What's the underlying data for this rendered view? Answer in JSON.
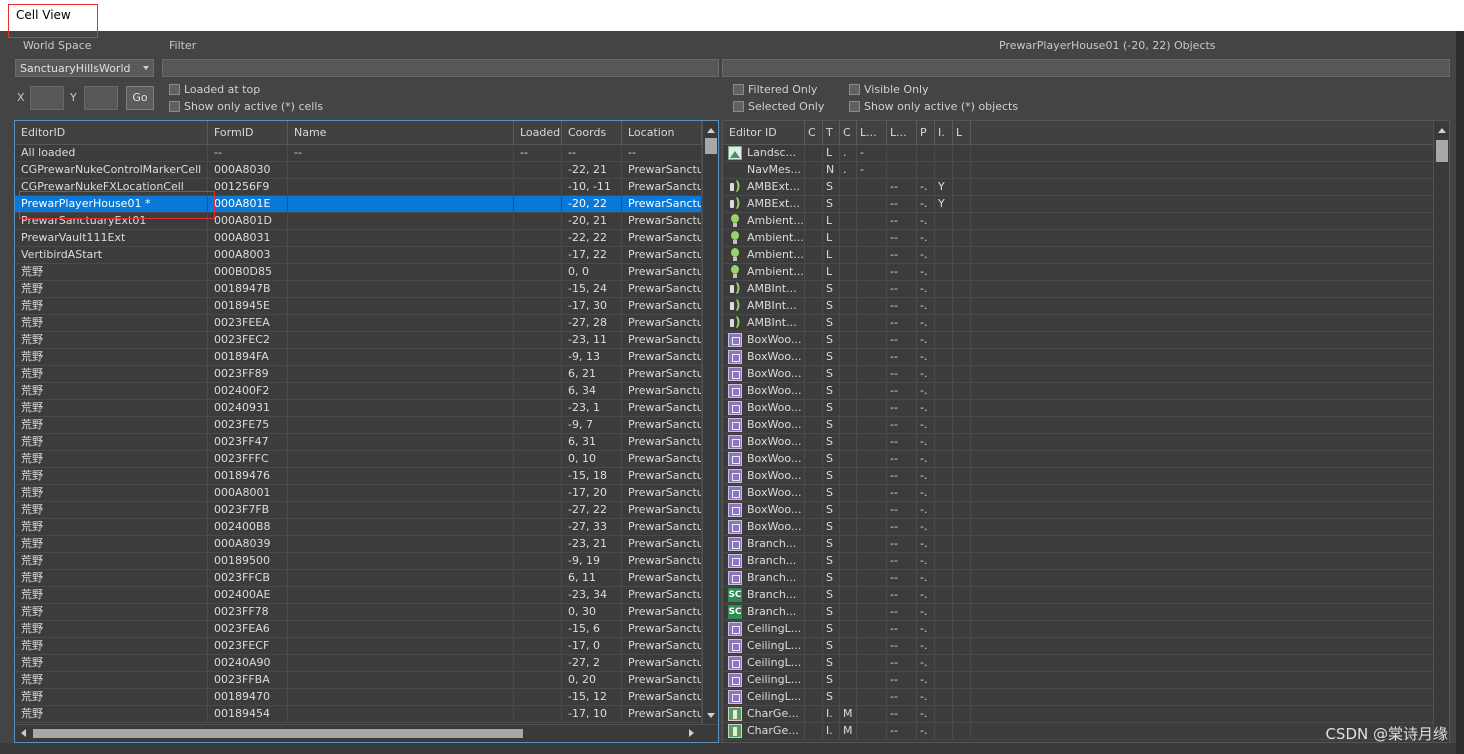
{
  "window": {
    "title": "Cell View"
  },
  "controls": {
    "world_space_label": "World Space",
    "filter_label": "Filter",
    "objects_title": "PrewarPlayerHouse01 (-20, 22) Objects",
    "world_space_value": "SanctuaryHillsWorld",
    "x_label": "X",
    "y_label": "Y",
    "go_label": "Go",
    "loaded_at_top": "Loaded at top",
    "show_active_cells": "Show only active (*) cells",
    "filtered_only": "Filtered Only",
    "visible_only": "Visible Only",
    "selected_only": "Selected Only",
    "show_active_objects": "Show only active (*) objects"
  },
  "cells": {
    "columns": [
      "EditorID",
      "FormID",
      "Name",
      "Loaded",
      "Coords",
      "Location"
    ],
    "rows": [
      [
        "All loaded",
        "--",
        "--",
        "--",
        "--",
        "--"
      ],
      [
        "CGPrewarNukeControlMarkerCell",
        "000A8030",
        "",
        "",
        "-22, 21",
        "PrewarSanctua"
      ],
      [
        "CGPrewarNukeFXLocationCell",
        "001256F9",
        "",
        "",
        "-10, -11",
        "PrewarSanctua"
      ],
      [
        "PrewarPlayerHouse01 *",
        "000A801E",
        "",
        "",
        "-20, 22",
        "PrewarSanctua"
      ],
      [
        "PrewarSanctuaryExt01",
        "000A801D",
        "",
        "",
        "-20, 21",
        "PrewarSanctua"
      ],
      [
        "PrewarVault111Ext",
        "000A8031",
        "",
        "",
        "-22, 22",
        "PrewarSanctua"
      ],
      [
        "VertibirdAStart",
        "000A8003",
        "",
        "",
        "-17, 22",
        "PrewarSanctua"
      ],
      [
        "荒野",
        "000B0D85",
        "",
        "",
        "0, 0",
        "PrewarSanctua"
      ],
      [
        "荒野",
        "0018947B",
        "",
        "",
        "-15, 24",
        "PrewarSanctua"
      ],
      [
        "荒野",
        "0018945E",
        "",
        "",
        "-17, 30",
        "PrewarSanctua"
      ],
      [
        "荒野",
        "0023FEEA",
        "",
        "",
        "-27, 28",
        "PrewarSanctua"
      ],
      [
        "荒野",
        "0023FEC2",
        "",
        "",
        "-23, 11",
        "PrewarSanctua"
      ],
      [
        "荒野",
        "001894FA",
        "",
        "",
        "-9, 13",
        "PrewarSanctua"
      ],
      [
        "荒野",
        "0023FF89",
        "",
        "",
        "6, 21",
        "PrewarSanctua"
      ],
      [
        "荒野",
        "002400F2",
        "",
        "",
        "6, 34",
        "PrewarSanctua"
      ],
      [
        "荒野",
        "00240931",
        "",
        "",
        "-23, 1",
        "PrewarSanctua"
      ],
      [
        "荒野",
        "0023FE75",
        "",
        "",
        "-9, 7",
        "PrewarSanctua"
      ],
      [
        "荒野",
        "0023FF47",
        "",
        "",
        "6, 31",
        "PrewarSanctua"
      ],
      [
        "荒野",
        "0023FFFC",
        "",
        "",
        "0, 10",
        "PrewarSanctua"
      ],
      [
        "荒野",
        "00189476",
        "",
        "",
        "-15, 18",
        "PrewarSanctua"
      ],
      [
        "荒野",
        "000A8001",
        "",
        "",
        "-17, 20",
        "PrewarSanctua"
      ],
      [
        "荒野",
        "0023F7FB",
        "",
        "",
        "-27, 22",
        "PrewarSanctua"
      ],
      [
        "荒野",
        "002400B8",
        "",
        "",
        "-27, 33",
        "PrewarSanctua"
      ],
      [
        "荒野",
        "000A8039",
        "",
        "",
        "-23, 21",
        "PrewarSanctua"
      ],
      [
        "荒野",
        "00189500",
        "",
        "",
        "-9, 19",
        "PrewarSanctua"
      ],
      [
        "荒野",
        "0023FFCB",
        "",
        "",
        "6, 11",
        "PrewarSanctua"
      ],
      [
        "荒野",
        "002400AE",
        "",
        "",
        "-23, 34",
        "PrewarSanctua"
      ],
      [
        "荒野",
        "0023FF78",
        "",
        "",
        "0, 30",
        "PrewarSanctua"
      ],
      [
        "荒野",
        "0023FEA6",
        "",
        "",
        "-15, 6",
        "PrewarSanctua"
      ],
      [
        "荒野",
        "0023FECF",
        "",
        "",
        "-17, 0",
        "PrewarSanctua"
      ],
      [
        "荒野",
        "00240A90",
        "",
        "",
        "-27, 2",
        "PrewarSanctua"
      ],
      [
        "荒野",
        "0023FFBA",
        "",
        "",
        "0, 20",
        "PrewarSanctua"
      ],
      [
        "荒野",
        "00189470",
        "",
        "",
        "-15, 12",
        "PrewarSanctua"
      ],
      [
        "荒野",
        "00189454",
        "",
        "",
        "-17, 10",
        "PrewarSanctua"
      ]
    ],
    "selected_index": 3
  },
  "objects": {
    "columns": [
      "Editor ID",
      "C",
      "T",
      "C",
      "L...",
      "L...",
      "P",
      "I.",
      "L"
    ],
    "rows": [
      {
        "icon": "landscape-icon",
        "cells": [
          "Landsc...",
          "",
          "L",
          ".",
          "-",
          "",
          "",
          "",
          ""
        ]
      },
      {
        "icon": "",
        "cells": [
          "NavMes...",
          "",
          "N",
          ".",
          "-",
          "",
          "",
          "",
          ""
        ]
      },
      {
        "icon": "sound-icon",
        "cells": [
          "AMBExt...",
          "",
          "S",
          "",
          "",
          "--",
          "-.",
          "Y",
          ""
        ]
      },
      {
        "icon": "sound-icon",
        "cells": [
          "AMBExt...",
          "",
          "S",
          "",
          "",
          "--",
          "-.",
          "Y",
          ""
        ]
      },
      {
        "icon": "light-bulb-icon",
        "cells": [
          "Ambient...",
          "",
          "L",
          "",
          "",
          "--",
          "-.",
          "",
          ""
        ]
      },
      {
        "icon": "light-bulb-icon",
        "cells": [
          "Ambient...",
          "",
          "L",
          "",
          "",
          "--",
          "-.",
          "",
          ""
        ]
      },
      {
        "icon": "light-bulb-icon",
        "cells": [
          "Ambient...",
          "",
          "L",
          "",
          "",
          "--",
          "-.",
          "",
          ""
        ]
      },
      {
        "icon": "light-bulb-icon",
        "cells": [
          "Ambient...",
          "",
          "L",
          "",
          "",
          "--",
          "-.",
          "",
          ""
        ]
      },
      {
        "icon": "sound-icon",
        "cells": [
          "AMBInt...",
          "",
          "S",
          "",
          "",
          "--",
          "-.",
          "",
          ""
        ]
      },
      {
        "icon": "sound-icon",
        "cells": [
          "AMBInt...",
          "",
          "S",
          "",
          "",
          "--",
          "-.",
          "",
          ""
        ]
      },
      {
        "icon": "sound-icon",
        "cells": [
          "AMBInt...",
          "",
          "S",
          "",
          "",
          "--",
          "-.",
          "",
          ""
        ]
      },
      {
        "icon": "box-icon",
        "cells": [
          "BoxWoo...",
          "",
          "S",
          "",
          "",
          "--",
          "-.",
          "",
          ""
        ]
      },
      {
        "icon": "box-icon",
        "cells": [
          "BoxWoo...",
          "",
          "S",
          "",
          "",
          "--",
          "-.",
          "",
          ""
        ]
      },
      {
        "icon": "box-icon",
        "cells": [
          "BoxWoo...",
          "",
          "S",
          "",
          "",
          "--",
          "-.",
          "",
          ""
        ]
      },
      {
        "icon": "box-icon",
        "cells": [
          "BoxWoo...",
          "",
          "S",
          "",
          "",
          "--",
          "-.",
          "",
          ""
        ]
      },
      {
        "icon": "box-icon",
        "cells": [
          "BoxWoo...",
          "",
          "S",
          "",
          "",
          "--",
          "-.",
          "",
          ""
        ]
      },
      {
        "icon": "box-icon",
        "cells": [
          "BoxWoo...",
          "",
          "S",
          "",
          "",
          "--",
          "-.",
          "",
          ""
        ]
      },
      {
        "icon": "box-icon",
        "cells": [
          "BoxWoo...",
          "",
          "S",
          "",
          "",
          "--",
          "-.",
          "",
          ""
        ]
      },
      {
        "icon": "box-icon",
        "cells": [
          "BoxWoo...",
          "",
          "S",
          "",
          "",
          "--",
          "-.",
          "",
          ""
        ]
      },
      {
        "icon": "box-icon",
        "cells": [
          "BoxWoo...",
          "",
          "S",
          "",
          "",
          "--",
          "-.",
          "",
          ""
        ]
      },
      {
        "icon": "box-icon",
        "cells": [
          "BoxWoo...",
          "",
          "S",
          "",
          "",
          "--",
          "-.",
          "",
          ""
        ]
      },
      {
        "icon": "box-icon",
        "cells": [
          "BoxWoo...",
          "",
          "S",
          "",
          "",
          "--",
          "-.",
          "",
          ""
        ]
      },
      {
        "icon": "box-icon",
        "cells": [
          "BoxWoo...",
          "",
          "S",
          "",
          "",
          "--",
          "-.",
          "",
          ""
        ]
      },
      {
        "icon": "box-icon",
        "cells": [
          "Branch...",
          "",
          "S",
          "",
          "",
          "--",
          "-.",
          "",
          ""
        ]
      },
      {
        "icon": "box-icon",
        "cells": [
          "Branch...",
          "",
          "S",
          "",
          "",
          "--",
          "-.",
          "",
          ""
        ]
      },
      {
        "icon": "box-icon",
        "cells": [
          "Branch...",
          "",
          "S",
          "",
          "",
          "--",
          "-.",
          "",
          ""
        ]
      },
      {
        "icon": "sc-icon",
        "cells": [
          "Branch...",
          "",
          "S",
          "",
          "",
          "--",
          "-.",
          "",
          ""
        ]
      },
      {
        "icon": "sc-icon",
        "cells": [
          "Branch...",
          "",
          "S",
          "",
          "",
          "--",
          "-.",
          "",
          ""
        ]
      },
      {
        "icon": "box-icon",
        "cells": [
          "CeilingL...",
          "",
          "S",
          "",
          "",
          "--",
          "-.",
          "",
          ""
        ]
      },
      {
        "icon": "box-icon",
        "cells": [
          "CeilingL...",
          "",
          "S",
          "",
          "",
          "--",
          "-.",
          "",
          ""
        ]
      },
      {
        "icon": "box-icon",
        "cells": [
          "CeilingL...",
          "",
          "S",
          "",
          "",
          "--",
          "-.",
          "",
          ""
        ]
      },
      {
        "icon": "box-icon",
        "cells": [
          "CeilingL...",
          "",
          "S",
          "",
          "",
          "--",
          "-.",
          "",
          ""
        ]
      },
      {
        "icon": "box-icon",
        "cells": [
          "CeilingL...",
          "",
          "S",
          "",
          "",
          "--",
          "-.",
          "",
          ""
        ]
      },
      {
        "icon": "character-icon",
        "cells": [
          "CharGe...",
          "",
          "I.",
          "M",
          "",
          "--",
          "-.",
          "",
          ""
        ]
      },
      {
        "icon": "character-icon",
        "cells": [
          "CharGe...",
          "",
          "I.",
          "M",
          "",
          "--",
          "-.",
          "",
          ""
        ]
      }
    ]
  },
  "watermark": "CSDN @棠诗月缘"
}
